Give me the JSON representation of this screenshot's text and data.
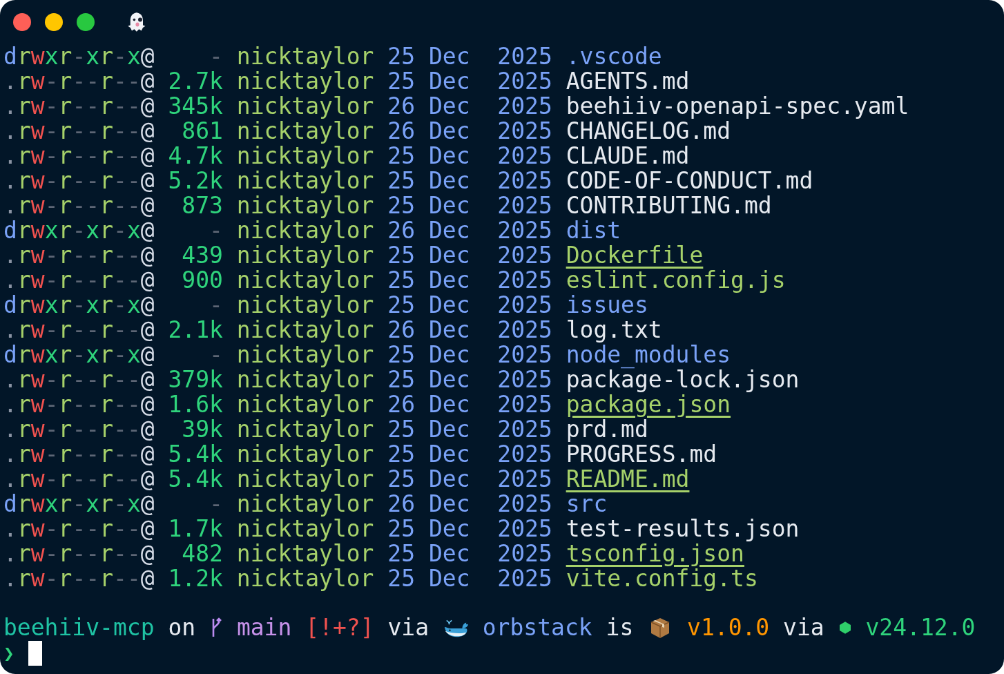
{
  "listing": [
    {
      "kind": "dir",
      "perms": "drwxr-xr-x@",
      "size": "-",
      "user": "nicktaylor",
      "day": "25",
      "month": "Dec",
      "year": "2025",
      "name": {
        "kind": "dir",
        "text": ".vscode"
      }
    },
    {
      "kind": "file",
      "perms": ".rw-r--r--@",
      "size": "2.7k",
      "user": "nicktaylor",
      "day": "25",
      "month": "Dec",
      "year": "2025",
      "name": {
        "kind": "plain",
        "text": "AGENTS.md"
      }
    },
    {
      "kind": "file",
      "perms": ".rw-r--r--@",
      "size": "345k",
      "user": "nicktaylor",
      "day": "26",
      "month": "Dec",
      "year": "2025",
      "name": {
        "kind": "plain",
        "text": "beehiiv-openapi-spec.yaml"
      }
    },
    {
      "kind": "file",
      "perms": ".rw-r--r--@",
      "size": "861",
      "user": "nicktaylor",
      "day": "26",
      "month": "Dec",
      "year": "2025",
      "name": {
        "kind": "plain",
        "text": "CHANGELOG.md"
      }
    },
    {
      "kind": "file",
      "perms": ".rw-r--r--@",
      "size": "4.7k",
      "user": "nicktaylor",
      "day": "25",
      "month": "Dec",
      "year": "2025",
      "name": {
        "kind": "plain",
        "text": "CLAUDE.md"
      }
    },
    {
      "kind": "file",
      "perms": ".rw-r--r--@",
      "size": "5.2k",
      "user": "nicktaylor",
      "day": "25",
      "month": "Dec",
      "year": "2025",
      "name": {
        "kind": "plain",
        "text": "CODE-OF-CONDUCT.md"
      }
    },
    {
      "kind": "file",
      "perms": ".rw-r--r--@",
      "size": "873",
      "user": "nicktaylor",
      "day": "25",
      "month": "Dec",
      "year": "2025",
      "name": {
        "kind": "plain",
        "text": "CONTRIBUTING.md"
      }
    },
    {
      "kind": "dir",
      "perms": "drwxr-xr-x@",
      "size": "-",
      "user": "nicktaylor",
      "day": "26",
      "month": "Dec",
      "year": "2025",
      "name": {
        "kind": "dir",
        "text": "dist"
      }
    },
    {
      "kind": "file",
      "perms": ".rw-r--r--@",
      "size": "439",
      "user": "nicktaylor",
      "day": "25",
      "month": "Dec",
      "year": "2025",
      "name": {
        "kind": "special",
        "text": "Dockerfile"
      }
    },
    {
      "kind": "file",
      "perms": ".rw-r--r--@",
      "size": "900",
      "user": "nicktaylor",
      "day": "25",
      "month": "Dec",
      "year": "2025",
      "name": {
        "kind": "config",
        "text": "eslint.config.js"
      }
    },
    {
      "kind": "dir",
      "perms": "drwxr-xr-x@",
      "size": "-",
      "user": "nicktaylor",
      "day": "25",
      "month": "Dec",
      "year": "2025",
      "name": {
        "kind": "dir",
        "text": "issues"
      }
    },
    {
      "kind": "file",
      "perms": ".rw-r--r--@",
      "size": "2.1k",
      "user": "nicktaylor",
      "day": "26",
      "month": "Dec",
      "year": "2025",
      "name": {
        "kind": "plain",
        "text": "log.txt"
      }
    },
    {
      "kind": "dir",
      "perms": "drwxr-xr-x@",
      "size": "-",
      "user": "nicktaylor",
      "day": "25",
      "month": "Dec",
      "year": "2025",
      "name": {
        "kind": "dir",
        "text": "node_modules"
      }
    },
    {
      "kind": "file",
      "perms": ".rw-r--r--@",
      "size": "379k",
      "user": "nicktaylor",
      "day": "25",
      "month": "Dec",
      "year": "2025",
      "name": {
        "kind": "plain",
        "text": "package-lock.json"
      }
    },
    {
      "kind": "file",
      "perms": ".rw-r--r--@",
      "size": "1.6k",
      "user": "nicktaylor",
      "day": "26",
      "month": "Dec",
      "year": "2025",
      "name": {
        "kind": "special",
        "text": "package.json"
      }
    },
    {
      "kind": "file",
      "perms": ".rw-r--r--@",
      "size": "39k",
      "user": "nicktaylor",
      "day": "25",
      "month": "Dec",
      "year": "2025",
      "name": {
        "kind": "plain",
        "text": "prd.md"
      }
    },
    {
      "kind": "file",
      "perms": ".rw-r--r--@",
      "size": "5.4k",
      "user": "nicktaylor",
      "day": "25",
      "month": "Dec",
      "year": "2025",
      "name": {
        "kind": "plain",
        "text": "PROGRESS.md"
      }
    },
    {
      "kind": "file",
      "perms": ".rw-r--r--@",
      "size": "5.4k",
      "user": "nicktaylor",
      "day": "25",
      "month": "Dec",
      "year": "2025",
      "name": {
        "kind": "special",
        "text": "README.md"
      }
    },
    {
      "kind": "dir",
      "perms": "drwxr-xr-x@",
      "size": "-",
      "user": "nicktaylor",
      "day": "26",
      "month": "Dec",
      "year": "2025",
      "name": {
        "kind": "dir",
        "text": "src"
      }
    },
    {
      "kind": "file",
      "perms": ".rw-r--r--@",
      "size": "1.7k",
      "user": "nicktaylor",
      "day": "25",
      "month": "Dec",
      "year": "2025",
      "name": {
        "kind": "plain",
        "text": "test-results.json"
      }
    },
    {
      "kind": "file",
      "perms": ".rw-r--r--@",
      "size": "482",
      "user": "nicktaylor",
      "day": "25",
      "month": "Dec",
      "year": "2025",
      "name": {
        "kind": "special",
        "text": "tsconfig.json"
      }
    },
    {
      "kind": "file",
      "perms": ".rw-r--r--@",
      "size": "1.2k",
      "user": "nicktaylor",
      "day": "25",
      "month": "Dec",
      "year": "2025",
      "name": {
        "kind": "config",
        "text": "vite.config.ts"
      }
    }
  ],
  "prompt": {
    "directory": "beehiiv-mcp",
    "on_word": "on",
    "branch": "main",
    "git_status": "[!+?]",
    "via_word": "via",
    "container": "orbstack",
    "is_word": "is",
    "version": "v1.0.0",
    "via_word_2": "via",
    "node_version": "v24.12.0",
    "symbol": "❯"
  }
}
